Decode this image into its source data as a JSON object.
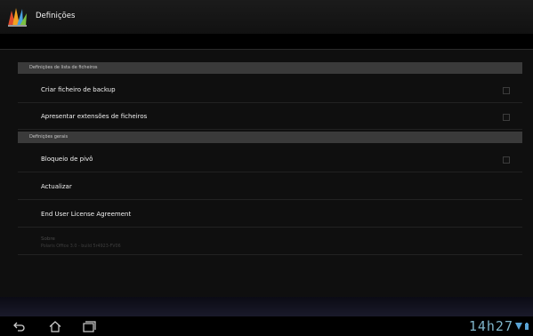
{
  "app": {
    "title": "Definições"
  },
  "sections": [
    {
      "header": "Definições de lista de ficheiros",
      "items": [
        {
          "label": "Criar ficheiro de backup",
          "checked": false
        },
        {
          "label": "Apresentar extensões de ficheiros",
          "checked": false
        }
      ]
    },
    {
      "header": "Definições gerais",
      "items": [
        {
          "label": "Bloqueio de pivô",
          "checked": false
        },
        {
          "label": "Actualizar"
        },
        {
          "label": "End User License Agreement"
        },
        {
          "label": "Sobre",
          "sublabel": "Polaris Office 3.0 - build 5r4923-FV06",
          "disabled": true
        }
      ]
    }
  ],
  "statusbar": {
    "time": "14h27"
  },
  "colors": {
    "accent_clock": "#7fb4c9",
    "section_header_bg": "#3a3a3a"
  },
  "icons": [
    "app-logo-icon",
    "back-icon",
    "home-icon",
    "recent-apps-icon",
    "wifi-icon",
    "battery-icon"
  ]
}
